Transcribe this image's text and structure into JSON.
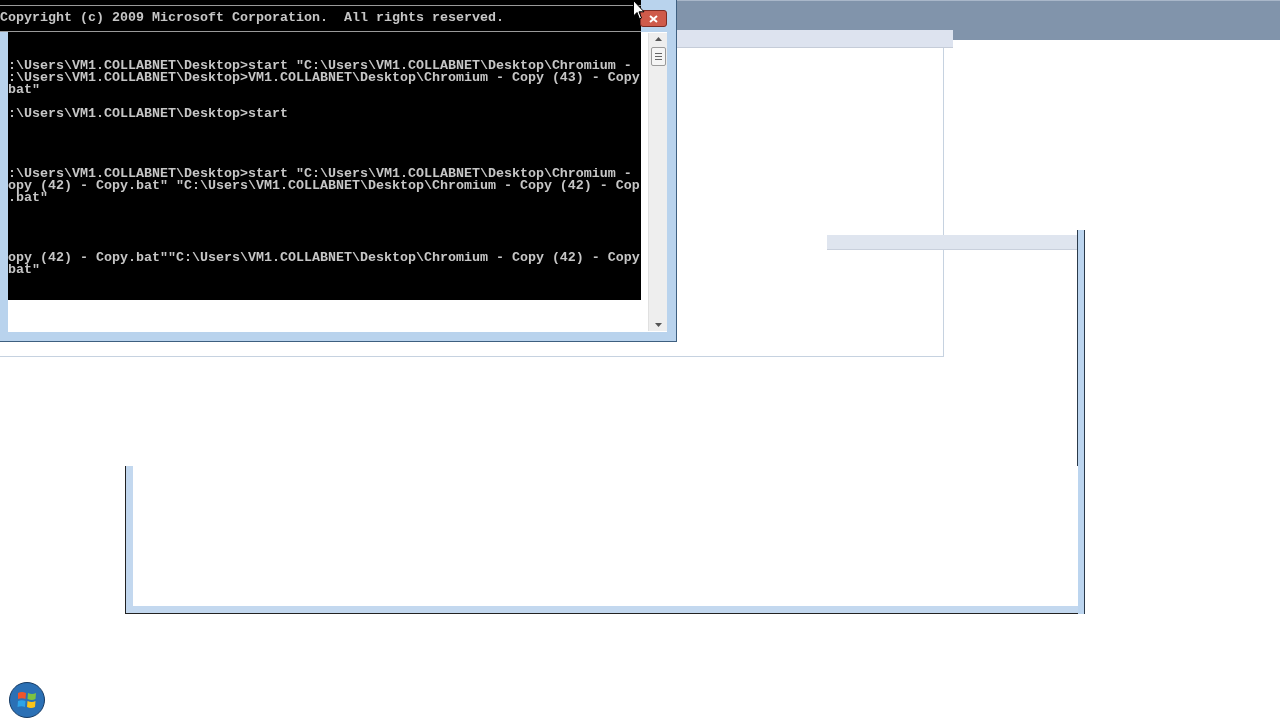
{
  "console": {
    "banner": "Copyright (c) 2009 Microsoft Corporation.  All rights reserved.",
    "blocks": [
      {
        "lines": [
          ":\\Users\\VM1.COLLABNET\\Desktop>start \"C:\\Users\\VM1.COLLABNET\\Desktop\\Chromium -",
          ":\\Users\\VM1.COLLABNET\\Desktop>VM1.COLLABNET\\Desktop\\Chromium - Copy (43) - Copy",
          "bat\""
        ]
      },
      {
        "lines": [
          ":\\Users\\VM1.COLLABNET\\Desktop>start"
        ]
      },
      {
        "lines": [
          ":\\Users\\VM1.COLLABNET\\Desktop>start \"C:\\Users\\VM1.COLLABNET\\Desktop\\Chromium -",
          "opy (42) - Copy.bat\" \"C:\\Users\\VM1.COLLABNET\\Desktop\\Chromium - Copy (42) - Cop",
          ".bat\""
        ]
      },
      {
        "lines": [
          "opy (42) - Copy.bat\"\"C:\\Users\\VM1.COLLABNET\\Desktop\\Chromium - Copy (42) - Copy",
          "bat\""
        ]
      }
    ]
  }
}
